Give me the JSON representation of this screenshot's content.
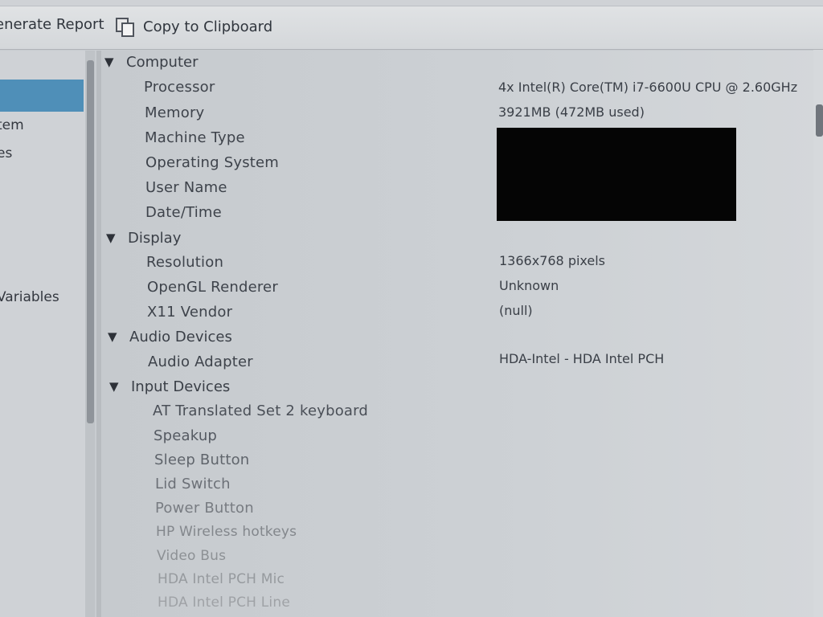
{
  "toolbar": {
    "generate_report_label": "enerate Report",
    "copy_label": "Copy to Clipboard"
  },
  "sidebar": {
    "items": [
      {
        "label": "tem"
      },
      {
        "label": "es"
      },
      {
        "label": "Variables"
      }
    ]
  },
  "tree": {
    "computer": {
      "label": "Computer",
      "rows": [
        {
          "label": "Processor",
          "value": "4x Intel(R) Core(TM) i7-6600U CPU @ 2.60GHz"
        },
        {
          "label": "Memory",
          "value": "3921MB (472MB used)"
        },
        {
          "label": "Machine Type",
          "value": ""
        },
        {
          "label": "Operating System",
          "value": ""
        },
        {
          "label": "User Name",
          "value": ""
        },
        {
          "label": "Date/Time",
          "value": ""
        }
      ]
    },
    "display": {
      "label": "Display",
      "rows": [
        {
          "label": "Resolution",
          "value": "1366x768 pixels"
        },
        {
          "label": "OpenGL Renderer",
          "value": "Unknown"
        },
        {
          "label": "X11 Vendor",
          "value": "(null)"
        }
      ]
    },
    "audio": {
      "label": "Audio Devices",
      "rows": [
        {
          "label": "Audio Adapter",
          "value": "HDA-Intel - HDA Intel PCH"
        }
      ]
    },
    "input": {
      "label": "Input Devices",
      "rows": [
        {
          "label": "AT Translated Set 2 keyboard"
        },
        {
          "label": "Speakup"
        },
        {
          "label": "Sleep Button"
        },
        {
          "label": "Lid Switch"
        },
        {
          "label": "Power Button"
        },
        {
          "label": "HP Wireless hotkeys"
        },
        {
          "label": "Video Bus"
        },
        {
          "label": "HDA Intel PCH Mic"
        },
        {
          "label": "HDA Intel PCH Line"
        }
      ]
    }
  },
  "arrow_glyph": "▼",
  "icons": {
    "copy": "clipboard-icon",
    "expand": "expander-arrow-icon"
  },
  "colors": {
    "selection": "#4f8fb8",
    "redaction": "#050505"
  }
}
